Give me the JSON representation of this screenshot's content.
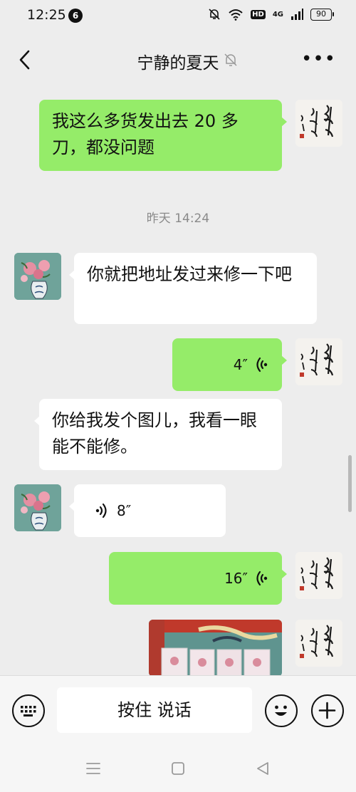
{
  "status_bar": {
    "time": "12:25",
    "notification_count": "6",
    "hd_label": "HD",
    "network_label": "4G",
    "battery": "90"
  },
  "header": {
    "title": "宁静的夏天",
    "icons": {
      "back": "chevron-left-icon",
      "mute": "bell-off-icon",
      "more": "more-dots-icon"
    }
  },
  "messages": {
    "msg1": {
      "sender": "self",
      "type": "text",
      "text": "我这么多货发出去 20 多刀，都没问题"
    },
    "time_divider": "昨天 14:24",
    "msg2": {
      "sender": "peer",
      "type": "text",
      "text": "你就把地址发过来修一下吧"
    },
    "msg3": {
      "sender": "self",
      "type": "voice",
      "duration": "4″"
    },
    "msg4": {
      "sender": "peer",
      "type": "text",
      "text": "你给我发个图儿，我看一眼能不能修。"
    },
    "msg5": {
      "sender": "peer",
      "type": "voice",
      "duration": "8″"
    },
    "msg6": {
      "sender": "self",
      "type": "voice",
      "duration": "16″"
    },
    "msg7": {
      "sender": "self",
      "type": "image"
    }
  },
  "input_bar": {
    "hold_to_talk_label": "按住 说话",
    "icons": {
      "keyboard": "keyboard-icon",
      "emoji": "emoji-icon",
      "plus": "plus-icon"
    }
  },
  "system_nav": {
    "icons": {
      "menu": "menu-icon",
      "home": "home-square-icon",
      "back": "back-triangle-icon"
    }
  },
  "colors": {
    "self_bubble": "#95ec69",
    "peer_bubble": "#ffffff",
    "chat_background": "#ededed",
    "timestamp": "#8a8a8a"
  }
}
